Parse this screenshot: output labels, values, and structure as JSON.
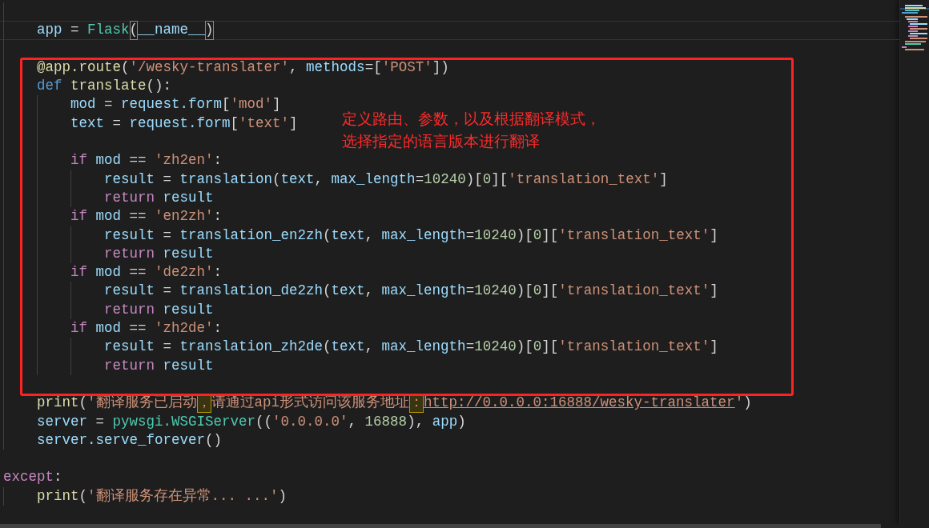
{
  "editor": {
    "lines": [
      {
        "current": false
      },
      {
        "current": true,
        "tokens": [
          {
            "kind": "var",
            "text": "    app"
          },
          {
            "kind": "plain",
            "text": " = "
          },
          {
            "kind": "class",
            "text": "Flask"
          },
          {
            "kind": "match",
            "text": "("
          },
          {
            "kind": "var",
            "text": "__name__"
          },
          {
            "kind": "match",
            "text": ")"
          }
        ]
      },
      {
        "current": false
      },
      {
        "current": false,
        "tokens": [
          {
            "kind": "func",
            "text": "    @app.route"
          },
          {
            "kind": "plain",
            "text": "("
          },
          {
            "kind": "string",
            "text": "'/wesky-translater'"
          },
          {
            "kind": "plain",
            "text": ", "
          },
          {
            "kind": "var",
            "text": "methods"
          },
          {
            "kind": "plain",
            "text": "=["
          },
          {
            "kind": "string",
            "text": "'POST'"
          },
          {
            "kind": "plain",
            "text": "])"
          }
        ]
      },
      {
        "current": false,
        "tokens": [
          {
            "kind": "keyword",
            "text": "    def"
          },
          {
            "kind": "func",
            "text": " translate"
          },
          {
            "kind": "plain",
            "text": "():"
          }
        ]
      },
      {
        "current": false,
        "tokens": [
          {
            "kind": "var",
            "text": "        mod"
          },
          {
            "kind": "plain",
            "text": " = "
          },
          {
            "kind": "var",
            "text": "request.form"
          },
          {
            "kind": "plain",
            "text": "["
          },
          {
            "kind": "string",
            "text": "'mod'"
          },
          {
            "kind": "plain",
            "text": "]"
          }
        ]
      },
      {
        "current": false,
        "tokens": [
          {
            "kind": "var",
            "text": "        text"
          },
          {
            "kind": "plain",
            "text": " = "
          },
          {
            "kind": "var",
            "text": "request.form"
          },
          {
            "kind": "plain",
            "text": "["
          },
          {
            "kind": "string",
            "text": "'text'"
          },
          {
            "kind": "plain",
            "text": "]"
          }
        ]
      },
      {
        "current": false
      },
      {
        "current": false,
        "tokens": [
          {
            "kind": "control",
            "text": "        if"
          },
          {
            "kind": "var",
            "text": " mod"
          },
          {
            "kind": "plain",
            "text": " == "
          },
          {
            "kind": "string",
            "text": "'zh2en'"
          },
          {
            "kind": "plain",
            "text": ":"
          }
        ]
      },
      {
        "current": false,
        "tokens": [
          {
            "kind": "var",
            "text": "            result"
          },
          {
            "kind": "plain",
            "text": " = "
          },
          {
            "kind": "var",
            "text": "translation"
          },
          {
            "kind": "plain",
            "text": "("
          },
          {
            "kind": "var",
            "text": "text"
          },
          {
            "kind": "plain",
            "text": ", "
          },
          {
            "kind": "var",
            "text": "max_length"
          },
          {
            "kind": "plain",
            "text": "="
          },
          {
            "kind": "number",
            "text": "10240"
          },
          {
            "kind": "plain",
            "text": ")["
          },
          {
            "kind": "number",
            "text": "0"
          },
          {
            "kind": "plain",
            "text": "]["
          },
          {
            "kind": "string",
            "text": "'translation_text'"
          },
          {
            "kind": "plain",
            "text": "]"
          }
        ]
      },
      {
        "current": false,
        "tokens": [
          {
            "kind": "control",
            "text": "            return"
          },
          {
            "kind": "var",
            "text": " result"
          }
        ]
      },
      {
        "current": false,
        "tokens": [
          {
            "kind": "control",
            "text": "        if"
          },
          {
            "kind": "var",
            "text": " mod"
          },
          {
            "kind": "plain",
            "text": " == "
          },
          {
            "kind": "string",
            "text": "'en2zh'"
          },
          {
            "kind": "plain",
            "text": ":"
          }
        ]
      },
      {
        "current": false,
        "tokens": [
          {
            "kind": "var",
            "text": "            result"
          },
          {
            "kind": "plain",
            "text": " = "
          },
          {
            "kind": "var",
            "text": "translation_en2zh"
          },
          {
            "kind": "plain",
            "text": "("
          },
          {
            "kind": "var",
            "text": "text"
          },
          {
            "kind": "plain",
            "text": ", "
          },
          {
            "kind": "var",
            "text": "max_length"
          },
          {
            "kind": "plain",
            "text": "="
          },
          {
            "kind": "number",
            "text": "10240"
          },
          {
            "kind": "plain",
            "text": ")["
          },
          {
            "kind": "number",
            "text": "0"
          },
          {
            "kind": "plain",
            "text": "]["
          },
          {
            "kind": "string",
            "text": "'translation_text'"
          },
          {
            "kind": "plain",
            "text": "]"
          }
        ]
      },
      {
        "current": false,
        "tokens": [
          {
            "kind": "control",
            "text": "            return"
          },
          {
            "kind": "var",
            "text": " result"
          }
        ]
      },
      {
        "current": false,
        "tokens": [
          {
            "kind": "control",
            "text": "        if"
          },
          {
            "kind": "var",
            "text": " mod"
          },
          {
            "kind": "plain",
            "text": " == "
          },
          {
            "kind": "string",
            "text": "'de2zh'"
          },
          {
            "kind": "plain",
            "text": ":"
          }
        ]
      },
      {
        "current": false,
        "tokens": [
          {
            "kind": "var",
            "text": "            result"
          },
          {
            "kind": "plain",
            "text": " = "
          },
          {
            "kind": "var",
            "text": "translation_de2zh"
          },
          {
            "kind": "plain",
            "text": "("
          },
          {
            "kind": "var",
            "text": "text"
          },
          {
            "kind": "plain",
            "text": ", "
          },
          {
            "kind": "var",
            "text": "max_length"
          },
          {
            "kind": "plain",
            "text": "="
          },
          {
            "kind": "number",
            "text": "10240"
          },
          {
            "kind": "plain",
            "text": ")["
          },
          {
            "kind": "number",
            "text": "0"
          },
          {
            "kind": "plain",
            "text": "]["
          },
          {
            "kind": "string",
            "text": "'translation_text'"
          },
          {
            "kind": "plain",
            "text": "]"
          }
        ]
      },
      {
        "current": false,
        "tokens": [
          {
            "kind": "control",
            "text": "            return"
          },
          {
            "kind": "var",
            "text": " result"
          }
        ]
      },
      {
        "current": false,
        "tokens": [
          {
            "kind": "control",
            "text": "        if"
          },
          {
            "kind": "var",
            "text": " mod"
          },
          {
            "kind": "plain",
            "text": " == "
          },
          {
            "kind": "string",
            "text": "'zh2de'"
          },
          {
            "kind": "plain",
            "text": ":"
          }
        ]
      },
      {
        "current": false,
        "tokens": [
          {
            "kind": "var",
            "text": "            result"
          },
          {
            "kind": "plain",
            "text": " = "
          },
          {
            "kind": "var",
            "text": "translation_zh2de"
          },
          {
            "kind": "plain",
            "text": "("
          },
          {
            "kind": "var",
            "text": "text"
          },
          {
            "kind": "plain",
            "text": ", "
          },
          {
            "kind": "var",
            "text": "max_length"
          },
          {
            "kind": "plain",
            "text": "="
          },
          {
            "kind": "number",
            "text": "10240"
          },
          {
            "kind": "plain",
            "text": ")["
          },
          {
            "kind": "number",
            "text": "0"
          },
          {
            "kind": "plain",
            "text": "]["
          },
          {
            "kind": "string",
            "text": "'translation_text'"
          },
          {
            "kind": "plain",
            "text": "]"
          }
        ]
      },
      {
        "current": false,
        "tokens": [
          {
            "kind": "control",
            "text": "            return"
          },
          {
            "kind": "var",
            "text": " result"
          }
        ]
      },
      {
        "current": false
      },
      {
        "current": false,
        "tokens": [
          {
            "kind": "func",
            "text": "    print"
          },
          {
            "kind": "plain",
            "text": "("
          },
          {
            "kind": "string",
            "text": "'翻译服务已启动"
          },
          {
            "kind": "warn",
            "text": "，"
          },
          {
            "kind": "string",
            "text": "请通过api形式访问该服务地址"
          },
          {
            "kind": "warn",
            "text": "："
          },
          {
            "kind": "link",
            "text": "http://0.0.0.0:16888/wesky-translater"
          },
          {
            "kind": "string",
            "text": "'"
          },
          {
            "kind": "plain",
            "text": ")"
          }
        ]
      },
      {
        "current": false,
        "tokens": [
          {
            "kind": "var",
            "text": "    server"
          },
          {
            "kind": "plain",
            "text": " = "
          },
          {
            "kind": "class",
            "text": "pywsgi.WSGIServer"
          },
          {
            "kind": "plain",
            "text": "(("
          },
          {
            "kind": "string",
            "text": "'0.0.0.0'"
          },
          {
            "kind": "plain",
            "text": ", "
          },
          {
            "kind": "number",
            "text": "16888"
          },
          {
            "kind": "plain",
            "text": "), "
          },
          {
            "kind": "var",
            "text": "app"
          },
          {
            "kind": "plain",
            "text": ")"
          }
        ]
      },
      {
        "current": false,
        "tokens": [
          {
            "kind": "var",
            "text": "    server.serve_forever"
          },
          {
            "kind": "plain",
            "text": "()"
          }
        ]
      },
      {
        "current": false
      },
      {
        "current": false,
        "tokens": [
          {
            "kind": "control",
            "text": "except"
          },
          {
            "kind": "plain",
            "text": ":"
          }
        ]
      },
      {
        "current": false,
        "tokens": [
          {
            "kind": "func",
            "text": "    print"
          },
          {
            "kind": "plain",
            "text": "("
          },
          {
            "kind": "string",
            "text": "'翻译服务存在异常... ...'"
          },
          {
            "kind": "plain",
            "text": ")"
          }
        ]
      }
    ]
  },
  "annotation": {
    "lines": [
      "定义路由、参数，以及根据翻译模式，",
      "选择指定的语言版本进行翻译"
    ]
  }
}
